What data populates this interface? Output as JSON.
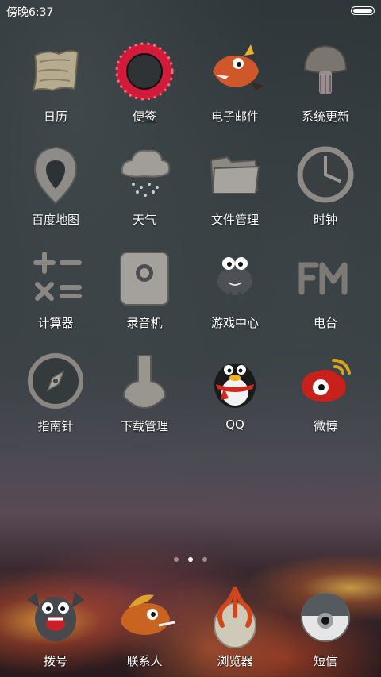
{
  "status_bar": {
    "time": "傍晚6:37"
  },
  "apps": [
    {
      "label": "日历",
      "icon": "calendar-stone-icon"
    },
    {
      "label": "便签",
      "icon": "notes-portal-icon"
    },
    {
      "label": "电子邮件",
      "icon": "email-creature-icon"
    },
    {
      "label": "系统更新",
      "icon": "mushroom-update-icon"
    },
    {
      "label": "百度地图",
      "icon": "map-pin-icon"
    },
    {
      "label": "天气",
      "icon": "cloud-rain-icon"
    },
    {
      "label": "文件管理",
      "icon": "folder-stone-icon"
    },
    {
      "label": "时钟",
      "icon": "clock-icon"
    },
    {
      "label": "计算器",
      "icon": "calculator-symbols-icon"
    },
    {
      "label": "录音机",
      "icon": "recorder-stone-icon"
    },
    {
      "label": "游戏中心",
      "icon": "game-creature-icon"
    },
    {
      "label": "电台",
      "icon": "fm-radio-icon"
    },
    {
      "label": "指南针",
      "icon": "compass-icon"
    },
    {
      "label": "下载管理",
      "icon": "download-arrow-icon"
    },
    {
      "label": "QQ",
      "icon": "qq-penguin-icon"
    },
    {
      "label": "微博",
      "icon": "weibo-eye-icon"
    }
  ],
  "page_indicator": {
    "count": 3,
    "active": 2
  },
  "dock": [
    {
      "label": "拨号",
      "icon": "phone-monster-icon"
    },
    {
      "label": "联系人",
      "icon": "contacts-dragon-icon"
    },
    {
      "label": "浏览器",
      "icon": "browser-egg-icon"
    },
    {
      "label": "短信",
      "icon": "message-eyeball-icon"
    }
  ]
}
